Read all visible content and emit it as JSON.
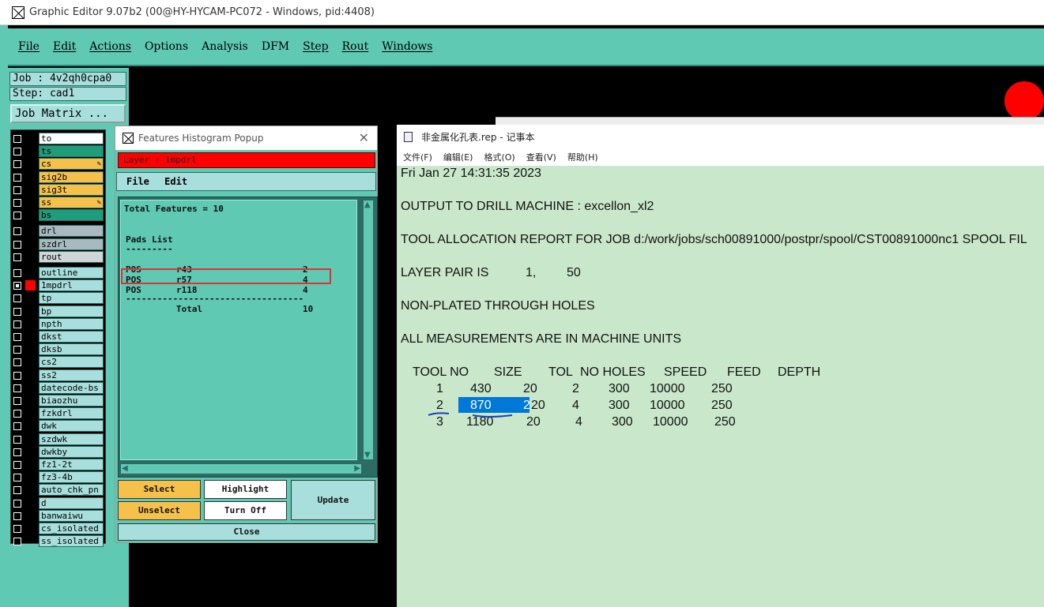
{
  "window": {
    "title": "Graphic Editor 9.07b2 (00@HY-HYCAM-PC072 - Windows, pid:4408)"
  },
  "menubar": {
    "items": [
      "File",
      "Edit",
      "Actions",
      "Options",
      "Analysis",
      "DFM",
      "Step",
      "Rout",
      "Windows"
    ]
  },
  "job": {
    "job_label": "Job : 4v2qh0cpa0",
    "step_label": "Step: cad1",
    "matrix_button": "Job Matrix ..."
  },
  "layers": [
    {
      "name": "to",
      "color": "#ffffff"
    },
    {
      "name": "ts",
      "color": "#1f9c7a"
    },
    {
      "name": "cs",
      "color": "#f5c14b",
      "editable": true
    },
    {
      "name": "sig2b",
      "color": "#f5c14b"
    },
    {
      "name": "sig3t",
      "color": "#f5c14b"
    },
    {
      "name": "ss",
      "color": "#f5c14b",
      "editable": true
    },
    {
      "name": "bs",
      "color": "#1f9c7a"
    },
    {
      "name": "drl",
      "color": "#a9b9c0"
    },
    {
      "name": "szdrl",
      "color": "#a9b9c0"
    },
    {
      "name": "rout",
      "color": "#d0d6d8"
    },
    {
      "name": "outline",
      "color": "#a8dedc"
    },
    {
      "name": "1mpdrl",
      "color": "#a8dedc",
      "active": true
    },
    {
      "name": "tp",
      "color": "#a8dedc"
    },
    {
      "name": "bp",
      "color": "#a8dedc"
    },
    {
      "name": "npth",
      "color": "#a8dedc"
    },
    {
      "name": "dkst",
      "color": "#a8dedc"
    },
    {
      "name": "dksb",
      "color": "#a8dedc"
    },
    {
      "name": "cs2",
      "color": "#a8dedc"
    },
    {
      "name": "ss2",
      "color": "#a8dedc"
    },
    {
      "name": "datecode-bs",
      "color": "#a8dedc"
    },
    {
      "name": "biaozhu",
      "color": "#a8dedc"
    },
    {
      "name": "fzkdrl",
      "color": "#a8dedc"
    },
    {
      "name": "dwk",
      "color": "#a8dedc"
    },
    {
      "name": "szdwk",
      "color": "#a8dedc"
    },
    {
      "name": "dwkby",
      "color": "#a8dedc"
    },
    {
      "name": "fz1-2t",
      "color": "#a8dedc"
    },
    {
      "name": "fz3-4b",
      "color": "#a8dedc"
    },
    {
      "name": "auto_chk_pn",
      "color": "#a8dedc"
    },
    {
      "name": "d",
      "color": "#a8dedc"
    },
    {
      "name": "banwaiwu",
      "color": "#a8dedc"
    },
    {
      "name": "cs_isolated",
      "color": "#a8dedc"
    },
    {
      "name": "ss_isolated",
      "color": "#a8dedc"
    }
  ],
  "popup": {
    "title": "Features Histogram Popup",
    "layer_field": "Layer :  1mpdrl",
    "menu": [
      "File",
      "Edit"
    ],
    "report": {
      "total": "Total Features = 10",
      "section": "Pads List",
      "underline": "---------",
      "rows": [
        {
          "type": "POS",
          "sym": "r43",
          "count": "2"
        },
        {
          "type": "POS",
          "sym": "r57",
          "count": "4"
        },
        {
          "type": "POS",
          "sym": "r118",
          "count": "4"
        }
      ],
      "separator": "----------------------------------",
      "total_label": "Total",
      "total_value": "10"
    },
    "buttons": {
      "select": "Select",
      "unselect": "Unselect",
      "highlight": "Highlight",
      "turn_off": "Turn Off",
      "update": "Update",
      "close": "Close"
    }
  },
  "notepad": {
    "title": "非金属化孔表.rep - 记事本",
    "menu": [
      "文件(F)",
      "编辑(E)",
      "格式(O)",
      "查看(V)",
      "帮助(H)"
    ],
    "lines": {
      "date": "Fri Jan 27 14:31:35 2023",
      "output": "OUTPUT TO DRILL MACHINE : excellon_xl2",
      "alloc": "TOOL ALLOCATION REPORT FOR JOB d:/work/jobs/sch00891000/postpr/spool/CST00891000nc1 SPOOL FIL",
      "pair_label": "LAYER PAIR IS",
      "pair_a": "1,",
      "pair_b": "50",
      "nonplated": "NON-PLATED THROUGH HOLES",
      "units": "ALL MEASUREMENTS ARE IN MACHINE UNITS"
    },
    "table": {
      "headers": [
        "TOOL NO",
        "SIZE",
        "TOL",
        "NO HOLES",
        "SPEED",
        "FEED",
        "DEPTH"
      ],
      "rows": [
        [
          "1",
          "430",
          "20",
          "2",
          "300",
          "10000",
          "250"
        ],
        [
          "2",
          "870",
          "20",
          "4",
          "300",
          "10000",
          "250"
        ],
        [
          "3",
          "1180",
          "20",
          "4",
          "300",
          "10000",
          "250"
        ]
      ],
      "selected_text": "870",
      "selected_after": "2"
    }
  }
}
